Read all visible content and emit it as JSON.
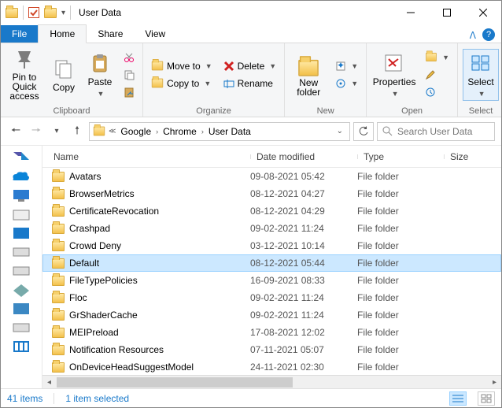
{
  "window": {
    "title": "User Data",
    "controls": {
      "minimize": "–",
      "maximize": "▢",
      "close": "✕"
    }
  },
  "tabs": {
    "file": "File",
    "home": "Home",
    "share": "Share",
    "view": "View"
  },
  "ribbon": {
    "clipboard": {
      "label": "Clipboard",
      "pin": "Pin to Quick\naccess",
      "copy": "Copy",
      "paste": "Paste"
    },
    "organize": {
      "label": "Organize",
      "move_to": "Move to",
      "copy_to": "Copy to",
      "delete": "Delete",
      "rename": "Rename"
    },
    "new": {
      "label": "New",
      "new_folder": "New\nfolder"
    },
    "open": {
      "label": "Open",
      "properties": "Properties"
    },
    "select": {
      "label": "Select",
      "select": "Select"
    }
  },
  "navbar": {
    "root_icon": "folder",
    "crumbs": [
      "Google",
      "Chrome",
      "User Data"
    ],
    "search_placeholder": "Search User Data"
  },
  "columns": {
    "name": "Name",
    "date": "Date modified",
    "type": "Type",
    "size": "Size"
  },
  "rows": [
    {
      "name": "Avatars",
      "date": "09-08-2021 05:42",
      "type": "File folder",
      "selected": false
    },
    {
      "name": "BrowserMetrics",
      "date": "08-12-2021 04:27",
      "type": "File folder",
      "selected": false
    },
    {
      "name": "CertificateRevocation",
      "date": "08-12-2021 04:29",
      "type": "File folder",
      "selected": false
    },
    {
      "name": "Crashpad",
      "date": "09-02-2021 11:24",
      "type": "File folder",
      "selected": false
    },
    {
      "name": "Crowd Deny",
      "date": "03-12-2021 10:14",
      "type": "File folder",
      "selected": false
    },
    {
      "name": "Default",
      "date": "08-12-2021 05:44",
      "type": "File folder",
      "selected": true
    },
    {
      "name": "FileTypePolicies",
      "date": "16-09-2021 08:33",
      "type": "File folder",
      "selected": false
    },
    {
      "name": "Floc",
      "date": "09-02-2021 11:24",
      "type": "File folder",
      "selected": false
    },
    {
      "name": "GrShaderCache",
      "date": "09-02-2021 11:24",
      "type": "File folder",
      "selected": false
    },
    {
      "name": "MEIPreload",
      "date": "17-08-2021 12:02",
      "type": "File folder",
      "selected": false
    },
    {
      "name": "Notification Resources",
      "date": "07-11-2021 05:07",
      "type": "File folder",
      "selected": false
    },
    {
      "name": "OnDeviceHeadSuggestModel",
      "date": "24-11-2021 02:30",
      "type": "File folder",
      "selected": false
    }
  ],
  "status": {
    "items": "41 items",
    "selected": "1 item selected"
  }
}
